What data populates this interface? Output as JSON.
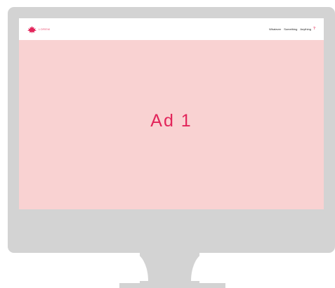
{
  "site": {
    "logo_text": "LOREM",
    "nav_items": [
      "Whatever",
      "Something",
      "Anything"
    ],
    "nav_question": "?"
  },
  "ad": {
    "label": "Ad 1"
  },
  "colors": {
    "bezel": "#d3d3d3",
    "ad_background": "#f9d2d2",
    "accent": "#e2245a"
  },
  "icons": {
    "logo": "maple-leaf-icon"
  }
}
